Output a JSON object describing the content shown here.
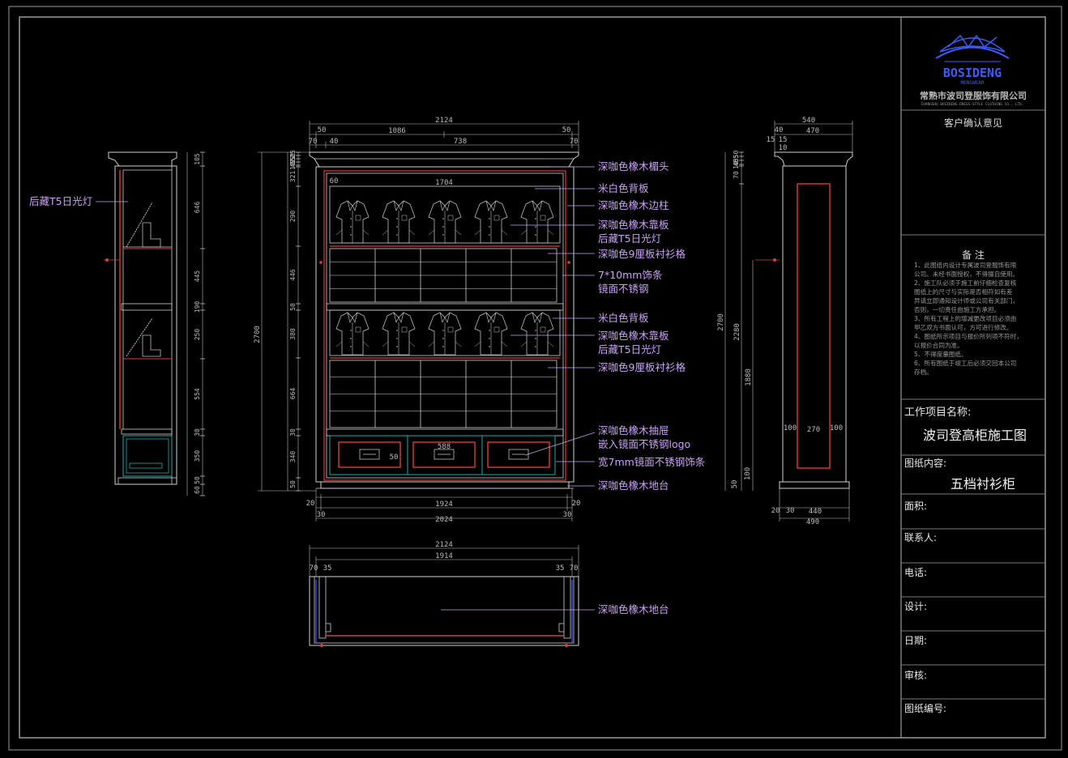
{
  "title_block": {
    "company_name": "常熟市波司登服饰有限公司",
    "company_name_en": "CHANGSHU BOSIDENG DRESS-STYLE CLOTHING CO., LTD.",
    "logo_text": "BOSIDENG",
    "logo_sub": "MENSWEAR",
    "client_opinion_label": "客户确认意见",
    "notes_title": "备 注",
    "notes": [
      "1、此图纸内设计专属波司登服饰有限",
      "公司。未经书面授权，不得擅自使用。",
      "2、施工队必须于施工前仔细检查复核",
      "图纸上的尺寸与实际是否相符如有差",
      "异请立即通知设计师或公司有关部门，",
      "否则，一切责任由施工方承担。",
      "3、所有工程上的增减更改项目必须由",
      "甲乙双方书面认可，方可进行修改。",
      "4、图纸所示项目与报价所列项不符时，",
      "以报价合同为准。",
      "5、不得度量图纸。",
      "6、所有图纸于竣工后必须交回本公司",
      "存档。"
    ],
    "project_name_label": "工作项目名称:",
    "project_name": "波司登高柜施工图",
    "drawing_content_label": "图纸内容:",
    "drawing_content": "五档衬衫柜",
    "area_label": "面积:",
    "contact_label": "联系人:",
    "phone_label": "电话:",
    "design_label": "设计:",
    "date_label": "日期:",
    "review_label": "审核:",
    "drawing_no_label": "图纸编号:"
  },
  "callouts": {
    "cornice": "深咖色橡木楣头",
    "back_panel_1": "米白色背板",
    "side_post": "深咖色橡木边柱",
    "screen_panel_1": "深咖色橡木靠板",
    "t5_light_1": "后藏T5日光灯",
    "shirt_grid_1": "深咖色9厘板衬衫格",
    "trim_strip": "7*10mm饰条",
    "trim_steel": "镜面不锈钢",
    "back_panel_2": "米白色背板",
    "screen_panel_2": "深咖色橡木靠板",
    "t5_light_2": "后藏T5日光灯",
    "shirt_grid_2": "深咖色9厘板衬衫格",
    "drawer": "深咖色橡木抽屉",
    "drawer_logo": "嵌入镜面不锈钢logo",
    "drawer_trim": "宽7mm镜面不锈钢饰条",
    "plinth": "深咖色橡木地台",
    "plan_plinth": "深咖色橡木地台",
    "side_light": "后藏T5日光灯"
  },
  "dims": {
    "front_total_top": "2124",
    "front_50_left": "50",
    "front_1086": "1086",
    "front_50_right": "50",
    "front_70_left": "70",
    "front_40": "40",
    "front_738": "738",
    "front_70_right": "70",
    "front_inner_60": "60",
    "front_inner_1704": "1704",
    "front_drawer_588": "588",
    "front_drawer_50": "50",
    "front_bottom_20_left": "20",
    "front_bottom_1924": "1924",
    "front_bottom_20_right": "20",
    "front_bottom_30_left": "30",
    "front_bottom_2024": "2024",
    "front_bottom_30_right": "30",
    "front_height_total": "2700",
    "front_v": [
      "25",
      "50",
      "55",
      "40",
      "10",
      "321",
      "290",
      "446",
      "50",
      "380",
      "664",
      "30",
      "340",
      "50"
    ],
    "side_v": [
      "105",
      "646",
      "445",
      "190",
      "250",
      "554",
      "30",
      "350",
      "50",
      "60"
    ],
    "right_top_540": "540",
    "right_40": "40",
    "right_470": "470",
    "right_15a": "15",
    "right_15b": "15",
    "right_10": "10",
    "right_v": [
      "50",
      "55",
      "40",
      "10",
      "70"
    ],
    "right_height_total": "2700",
    "right_2280": "2280",
    "right_1880": "1880",
    "right_100_left": "100",
    "right_270": "270",
    "right_100_right": "100",
    "right_50_bottom": "50",
    "right_100_bottom": "100",
    "right_b_20": "20",
    "right_b_30": "30",
    "right_b_440": "440",
    "right_b_490": "490",
    "plan_2124": "2124",
    "plan_1914": "1914",
    "plan_70_left": "70",
    "plan_35_left": "35",
    "plan_35_right": "35",
    "plan_70_right": "70"
  }
}
